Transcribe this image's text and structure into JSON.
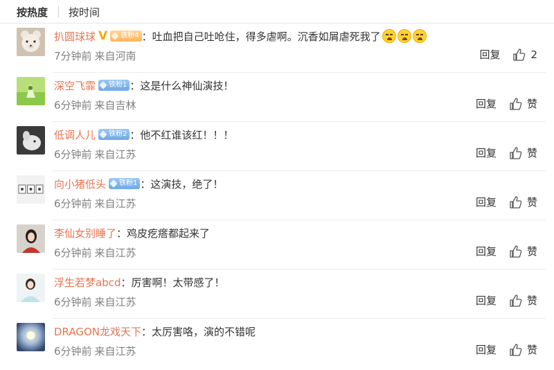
{
  "sort": {
    "hot": "按热度",
    "time": "按时间"
  },
  "comments": [
    {
      "user": "扒圆球球",
      "badge": "铁粉4",
      "text": "：吐血把自己吐呛住，得多虐啊。沉香如屑虐死我了",
      "time": "7分钟前",
      "loc": "来自河南",
      "reply": "回复",
      "like": "2"
    },
    {
      "user": "深空飞霏",
      "badge": "铁粉1",
      "text": "：这是什么神仙演技！",
      "time": "6分钟前",
      "loc": "来自吉林",
      "reply": "回复",
      "like": "赞"
    },
    {
      "user": "低调人儿",
      "badge": "铁粉2",
      "text": "：他不红谁该红！！！",
      "time": "6分钟前",
      "loc": "来自江苏",
      "reply": "回复",
      "like": "赞"
    },
    {
      "user": "向小猪低头",
      "badge": "铁粉1",
      "text": "：这演技，绝了！",
      "time": "6分钟前",
      "loc": "来自江苏",
      "reply": "回复",
      "like": "赞"
    },
    {
      "user": "李仙女别睡了",
      "text": "：鸡皮疙瘩都起来了",
      "time": "6分钟前",
      "loc": "来自江苏",
      "reply": "回复",
      "like": "赞"
    },
    {
      "user": "浮生若梦abcd",
      "text": "：厉害啊！太带感了！",
      "time": "6分钟前",
      "loc": "来自江苏",
      "reply": "回复",
      "like": "赞"
    },
    {
      "user": "DRAGON龙戏天下",
      "text": "：太厉害咯，演的不错呢",
      "time": "6分钟前",
      "loc": "来自江苏",
      "reply": "回复",
      "like": "赞"
    }
  ],
  "colors": {
    "username": "#eb7350",
    "vip": "#f7a800",
    "meta": "#808080"
  }
}
